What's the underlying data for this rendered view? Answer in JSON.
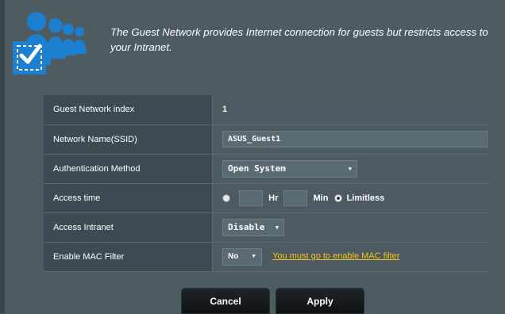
{
  "header": {
    "description": "The Guest Network provides Internet connection for guests but restricts access to your Intranet."
  },
  "rows": {
    "index": {
      "label": "Guest Network index",
      "value": "1"
    },
    "ssid": {
      "label": "Network Name(SSID)",
      "value": "ASUS_Guest1"
    },
    "auth": {
      "label": "Authentication Method",
      "value": "Open System"
    },
    "access_time": {
      "label": "Access time",
      "hr_unit": "Hr",
      "min_unit": "Min",
      "limitless_label": "Limitless"
    },
    "intranet": {
      "label": "Access Intranet",
      "value": "Disable"
    },
    "mac": {
      "label": "Enable MAC Filter",
      "value": "No",
      "link": "You must go to enable MAC filter"
    }
  },
  "buttons": {
    "cancel": "Cancel",
    "apply": "Apply"
  },
  "colors": {
    "background": "#4e5b61",
    "label_bg": "#3d4a51",
    "link": "#f3c31a",
    "accent_blue": "#1c7fd0"
  },
  "icons": {
    "logo": "guest-users-check-icon",
    "dropdown": "triangle-down-icon"
  }
}
